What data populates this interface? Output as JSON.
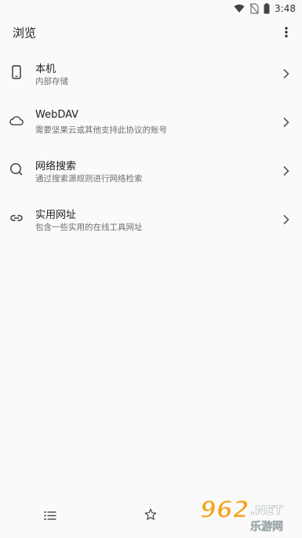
{
  "status_bar": {
    "time": "3:48",
    "icons": [
      "wifi-icon",
      "no-sim-icon",
      "battery-icon"
    ]
  },
  "app_bar": {
    "title": "浏览",
    "menu_icon": "more-vert-icon"
  },
  "items": [
    {
      "title": "本机",
      "subtitle": "内部存储",
      "icon": "phone-icon"
    },
    {
      "title": "WebDAV",
      "subtitle": "需要坚果云或其他支持此协议的账号",
      "icon": "cloud-icon"
    },
    {
      "title": "网络搜索",
      "subtitle": "通过搜索源规则进行网络检索",
      "icon": "search-icon"
    },
    {
      "title": "实用网址",
      "subtitle": "包含一些实用的在线工具网址",
      "icon": "link-icon"
    }
  ],
  "bottom_nav": {
    "items": [
      "list-icon",
      "star-icon"
    ]
  },
  "watermark": {
    "brand_number": "962",
    "brand_suffix": ".NET",
    "brand_cn": "乐游网",
    "colors": {
      "accent": "#f39c12",
      "outline": "#ffffff"
    }
  },
  "colors": {
    "background": "#fafafa",
    "primary_text": "#222222",
    "secondary_text": "#6f6f6f"
  }
}
